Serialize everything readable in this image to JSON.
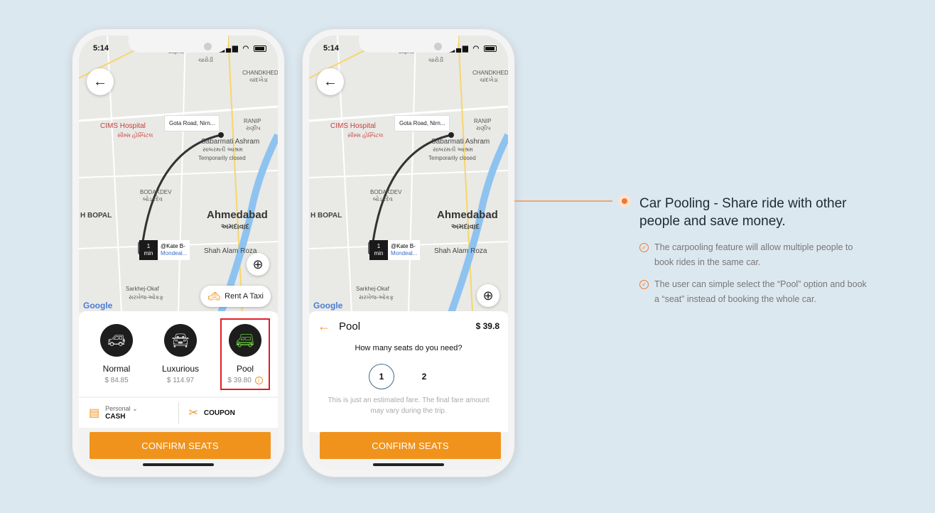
{
  "phone_left": {
    "status": {
      "time": "5:14",
      "icons": "▲ ✈"
    },
    "map": {
      "labels": [
        "Lapka",
        "ચારોડી",
        "CHANDKHEDA",
        "ચાંદખેડા",
        "CIMS Hospital",
        "સીમ્સ હોસ્પિટલ",
        "RANIP",
        "રાણીપ",
        "Sabarmati Ashram",
        "સાબરમતી આશ્રમ",
        "Temporarily closed",
        "BODAKDEV",
        "બોડકદેવ",
        "H BOPAL",
        "Ahmedabad",
        "અમદાવાદ",
        "Shah Alam Roza",
        "Sarkhej-Okaf",
        "સરખેજ-ઓકફ",
        "Google"
      ],
      "destination": "Gota Road, Nirn...",
      "eta_value": "1",
      "eta_unit": "min",
      "pickup": "@Kate B-",
      "pickup_sub": "Mondeal..."
    },
    "rent_label": "Rent A Taxi",
    "rides": [
      {
        "name": "Normal",
        "price": "$ 84.85"
      },
      {
        "name": "Luxurious",
        "price": "$ 114.97"
      },
      {
        "name": "Pool",
        "price": "$ 39.80",
        "selected": true
      }
    ],
    "payment": {
      "type_label": "Personal",
      "method": "CASH",
      "coupon": "COUPON"
    },
    "confirm_label": "CONFIRM SEATS"
  },
  "phone_right": {
    "status": {
      "time": "5:14"
    },
    "pool_title": "Pool",
    "pool_amount": "$ 39.8",
    "seat_question": "How many seats do you need?",
    "seat_options": [
      "1",
      "2"
    ],
    "selected_seat": "1",
    "fare_note": "This is just an estimated fare. The final fare amount may vary during the trip.",
    "confirm_label": "CONFIRM SEATS"
  },
  "feature": {
    "title": "Car Pooling - Share ride with other people and save money.",
    "points": [
      "The carpooling feature will allow multiple people to book rides in the same car.",
      "The user can simple select the “Pool” option and book a “seat” instead of booking the whole car."
    ]
  },
  "colors": {
    "accent": "#f0931c",
    "bullet": "#ee7a32",
    "selection": "#e01f24",
    "background": "#dce8f0"
  }
}
